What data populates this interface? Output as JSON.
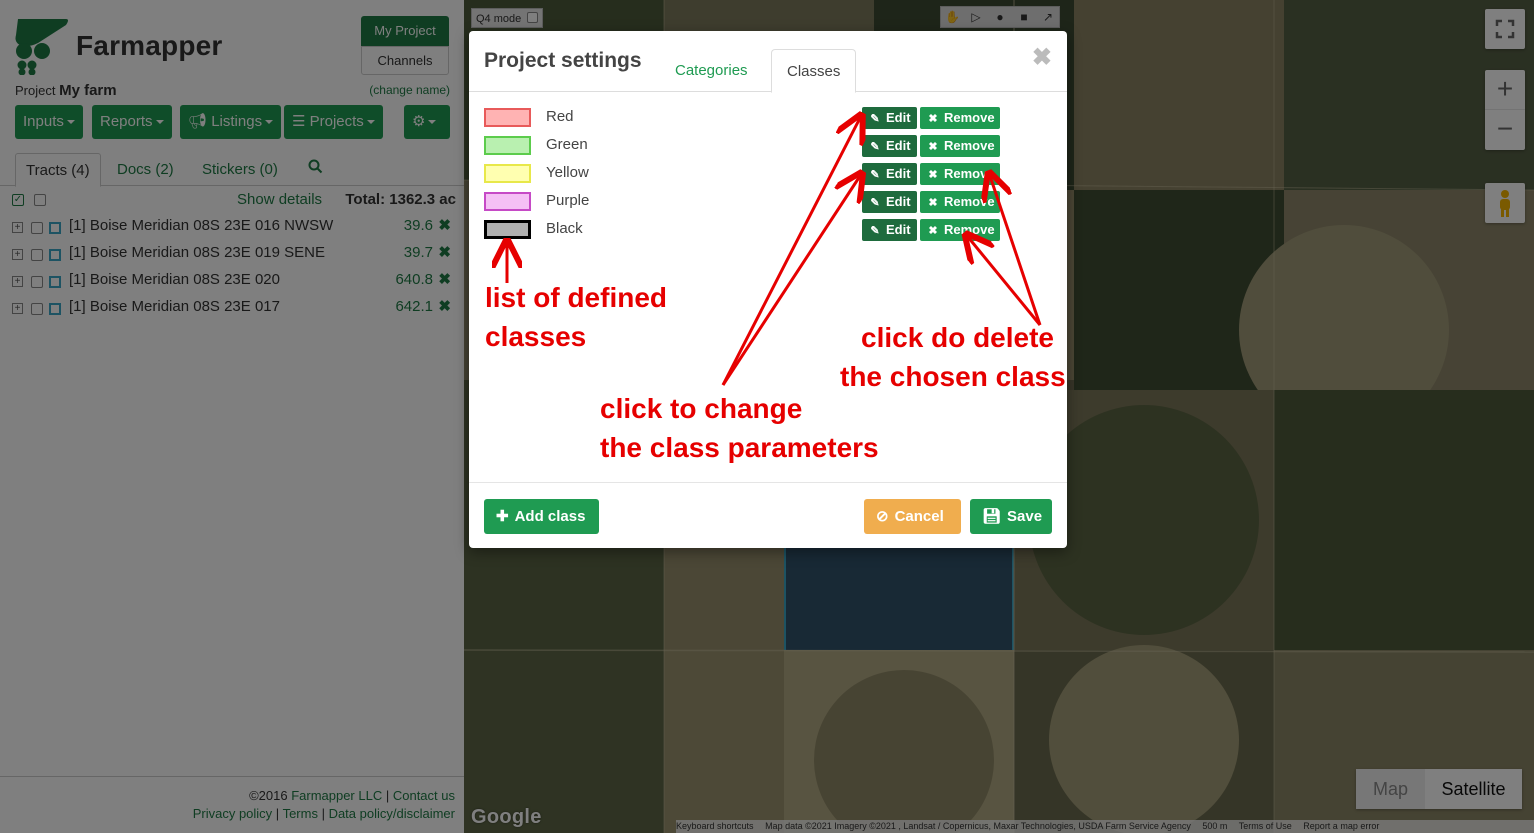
{
  "brand": {
    "name": "Farmapper"
  },
  "header": {
    "my_project": "My Project",
    "channels": "Channels",
    "project_prefix": "Project",
    "project_name": "My farm",
    "change_name": "(change name)"
  },
  "nav": {
    "inputs": "Inputs",
    "reports": "Reports",
    "listings": "Listings",
    "projects": "Projects"
  },
  "tabs": {
    "tracts": "Tracts (4)",
    "docs": "Docs (2)",
    "stickers": "Stickers (0)"
  },
  "tracts_header": {
    "show_details": "Show details",
    "total": "Total: 1362.3 ac"
  },
  "tracts": [
    {
      "name": "[1] Boise Meridian 08S 23E 016 NWSW",
      "value": "39.6"
    },
    {
      "name": "[1] Boise Meridian 08S 23E 019 SENE",
      "value": "39.7"
    },
    {
      "name": "[1] Boise Meridian 08S 23E 020",
      "value": "640.8"
    },
    {
      "name": "[1] Boise Meridian 08S 23E 017",
      "value": "642.1"
    }
  ],
  "footer": {
    "copyright": "©2016",
    "company": "Farmapper LLC",
    "contact": "Contact us",
    "privacy": "Privacy policy",
    "terms": "Terms",
    "data_policy": "Data policy/disclaimer"
  },
  "map": {
    "q4_mode": "Q4 mode",
    "map_label": "Map",
    "satellite_label": "Satellite",
    "google": "Google",
    "attribution": {
      "shortcuts": "Keyboard shortcuts",
      "data": "Map data ©2021 Imagery ©2021 , Landsat / Copernicus, Maxar Technologies, USDA Farm Service Agency",
      "scale": "500 m",
      "terms": "Terms of Use",
      "report": "Report a map error"
    }
  },
  "modal": {
    "title": "Project settings",
    "tab_categories": "Categories",
    "tab_classes": "Classes",
    "classes": [
      {
        "name": "Red",
        "fill": "#ffb3b3",
        "border": "#e85a5a"
      },
      {
        "name": "Green",
        "fill": "#b9f0b0",
        "border": "#5ccc4c"
      },
      {
        "name": "Yellow",
        "fill": "#ffffb0",
        "border": "#e8e84a"
      },
      {
        "name": "Purple",
        "fill": "#f5c0f5",
        "border": "#c64ac6"
      },
      {
        "name": "Black",
        "fill": "#b0b0b0",
        "border": "#000000"
      }
    ],
    "edit_label": "Edit",
    "remove_label": "Remove",
    "add_class": "Add class",
    "cancel": "Cancel",
    "save": "Save"
  },
  "annotations": {
    "list_line1": "list of defined",
    "list_line2": "classes",
    "change_line1": "click to change",
    "change_line2": "the class parameters",
    "delete_line1": "click do delete",
    "delete_line2": "the chosen class"
  }
}
